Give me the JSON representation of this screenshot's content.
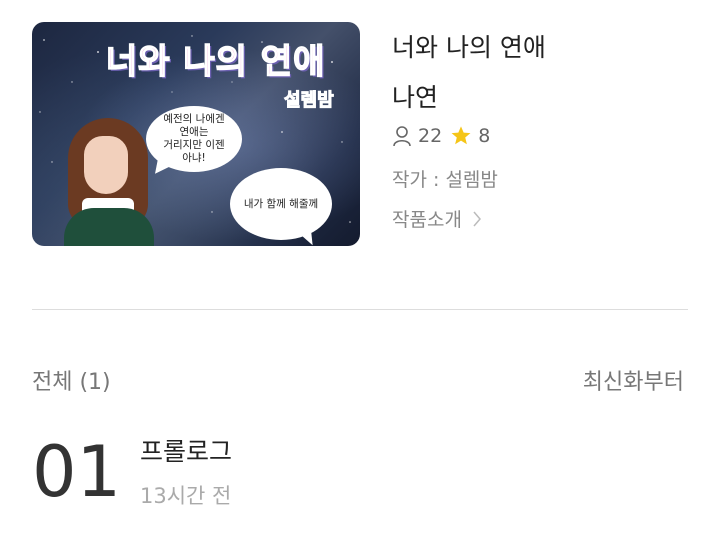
{
  "cover": {
    "title_art": "너와 나의 연애",
    "author_art": "설렘밤",
    "bubble1": "예전의 나에겐\n연애는\n거리지만 이젠\n아냐!",
    "bubble2": "내가 함께 해줄께"
  },
  "novel": {
    "title": "너와 나의 연애",
    "subtitle": "나연",
    "readers": "22",
    "stars": "8",
    "author_line": "작가 : 설렘밤",
    "intro_label": "작품소개"
  },
  "list": {
    "total_label": "전체 (1)",
    "sort_label": "최신화부터"
  },
  "episodes": [
    {
      "number": "01",
      "title": "프롤로그",
      "time": "13시간 전"
    }
  ],
  "colors": {
    "star": "#f5c518",
    "divider": "#dddddd"
  },
  "icons": {
    "readers": "person-icon",
    "stars": "star-icon",
    "intro": "chevron-right-icon"
  }
}
